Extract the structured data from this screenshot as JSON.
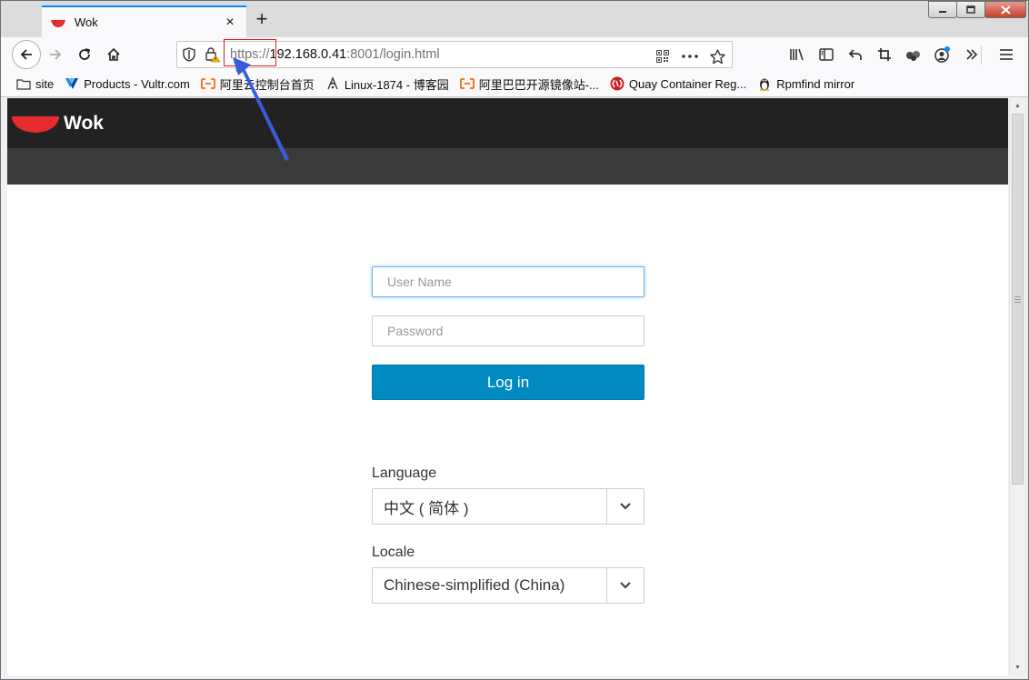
{
  "browser": {
    "tab": {
      "title": "Wok",
      "close": "×"
    },
    "new_tab": "+",
    "window_controls": {
      "minimize": "—",
      "maximize": "□",
      "close": "✕"
    },
    "url": {
      "scheme": "https://",
      "host": "192.168.0.41",
      "rest": ":8001/login.html"
    }
  },
  "bookmarks": [
    {
      "label": "site",
      "icon": "folder-icon"
    },
    {
      "label": "Products - Vultr.com",
      "icon": "vultr-icon"
    },
    {
      "label": "阿里云控制台首页",
      "icon": "aliyun-icon"
    },
    {
      "label": "Linux-1874 - 博客园",
      "icon": "cnblogs-icon"
    },
    {
      "label": "阿里巴巴开源镜像站-...",
      "icon": "aliyun-icon"
    },
    {
      "label": "Quay Container Reg...",
      "icon": "quay-icon"
    },
    {
      "label": "Rpmfind mirror",
      "icon": "tux-icon"
    }
  ],
  "wok": {
    "brand": "Wok",
    "accent": "#e52b2b"
  },
  "login": {
    "username_placeholder": "User Name",
    "password_placeholder": "Password",
    "login_label": "Log in",
    "button_color": "#008abf"
  },
  "language": {
    "label": "Language",
    "selected": "中文 ( 简体 )"
  },
  "locale": {
    "label": "Locale",
    "selected": "Chinese-simplified (China)"
  },
  "annotation": {
    "color": "#e02020",
    "arrow_color": "#3a5cd8"
  }
}
